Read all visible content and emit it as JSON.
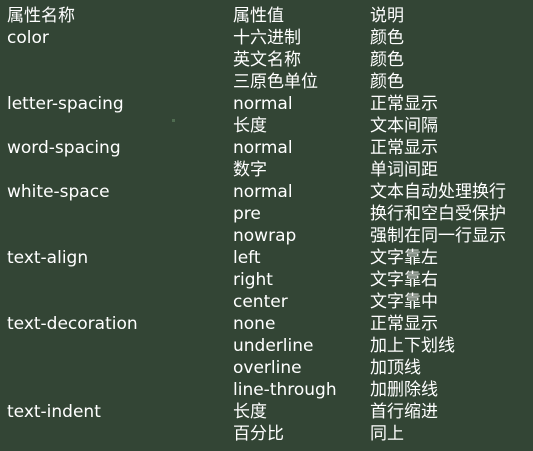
{
  "headers": {
    "name": "属性名称",
    "value": "属性值",
    "description": "说明"
  },
  "rows": [
    {
      "name": "color",
      "value": "十六进制",
      "description": "颜色"
    },
    {
      "name": "",
      "value": "英文名称",
      "description": "颜色"
    },
    {
      "name": "",
      "value": "三原色单位",
      "description": "颜色"
    },
    {
      "name": "letter-spacing",
      "value": "normal",
      "description": "正常显示"
    },
    {
      "name": "",
      "value": "长度",
      "description": "文本间隔"
    },
    {
      "name": "word-spacing",
      "value": "normal",
      "description": "正常显示"
    },
    {
      "name": "",
      "value": "数字",
      "description": "单词间距"
    },
    {
      "name": "white-space",
      "value": "normal",
      "description": "文本自动处理换行"
    },
    {
      "name": "",
      "value": "pre",
      "description": "换行和空白受保护"
    },
    {
      "name": "",
      "value": "nowrap",
      "description": "强制在同一行显示"
    },
    {
      "name": "text-align",
      "value": "left",
      "description": "文字靠左"
    },
    {
      "name": "",
      "value": "right",
      "description": "文字靠右"
    },
    {
      "name": "",
      "value": "center",
      "description": "文字靠中"
    },
    {
      "name": "text-decoration",
      "value": "none",
      "description": "正常显示"
    },
    {
      "name": "",
      "value": "underline",
      "description": "加上下划线"
    },
    {
      "name": "",
      "value": "overline",
      "description": "加顶线"
    },
    {
      "name": "",
      "value": "line-through",
      "description": "加删除线"
    },
    {
      "name": "text-indent",
      "value": "长度",
      "description": "首行缩进"
    },
    {
      "name": "",
      "value": "百分比",
      "description": "同上"
    }
  ]
}
